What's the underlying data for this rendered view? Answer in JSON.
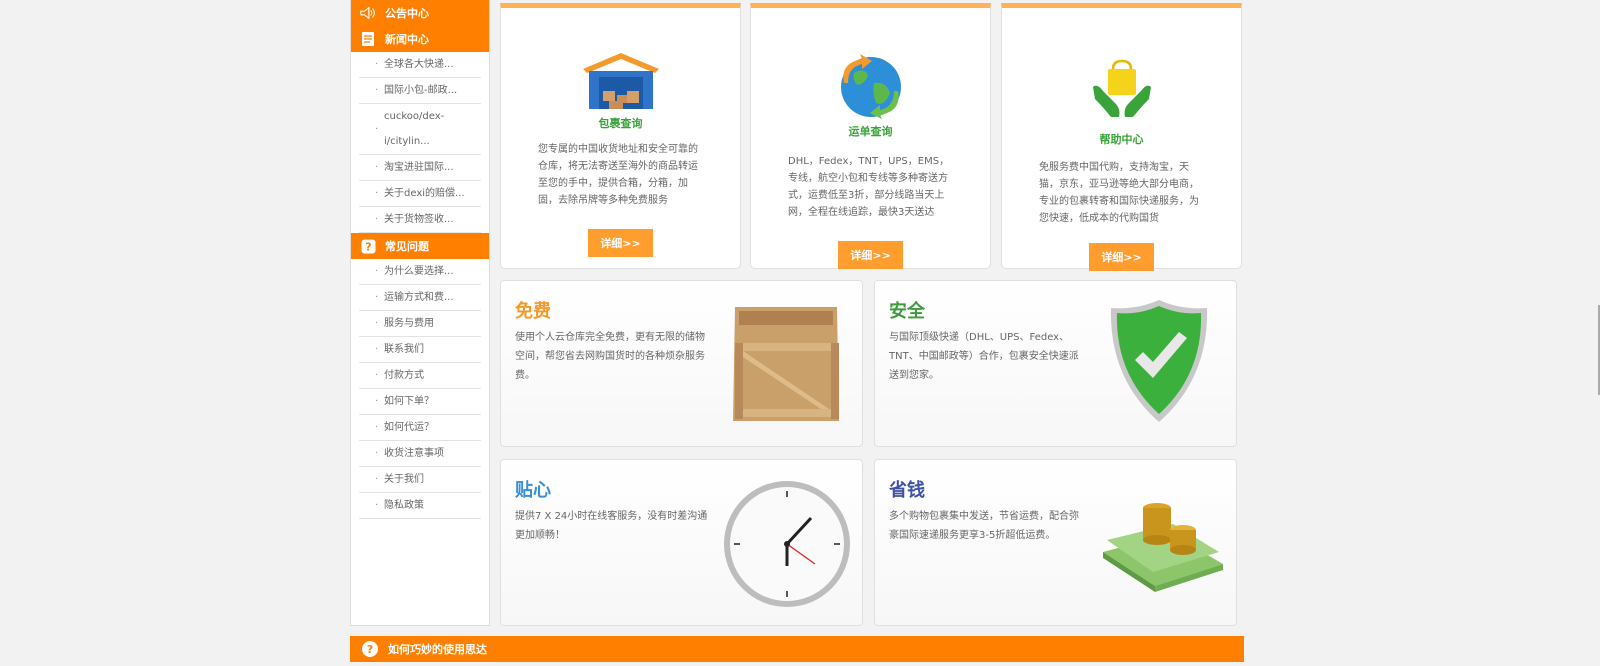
{
  "sidebar": {
    "announce_label": "公告中心",
    "news_label": "新闻中心",
    "news_items": [
      "全球各大快递...",
      "国际小包-邮政...",
      "cuckoo/dex-i/citylin...",
      "淘宝进驻国际...",
      "关于dexi的赔偿...",
      "关于货物签收..."
    ],
    "faq_label": "常见问题",
    "faq_items": [
      "为什么要选择...",
      "运输方式和费...",
      "服务与费用",
      "联系我们",
      "付款方式",
      "如何下单？",
      "如何代运？",
      "收货注意事项",
      "关于我们",
      "隐私政策"
    ]
  },
  "cards": [
    {
      "title": "包裹查询",
      "desc": "您专属的中国收货地址和安全可靠的仓库，将无法寄送至海外的商品转运至您的手中，提供合箱，分箱，加固，去除吊牌等多种免费服务",
      "button": "详细>>",
      "icon": "warehouse-icon"
    },
    {
      "title": "运单查询",
      "desc": "DHL，Fedex，TNT，UPS，EMS，专线，航空小包和专线等多种寄送方式，运费低至3折，部分线路当天上网，全程在线追踪，最快3天送达",
      "button": "详细>>",
      "icon": "globe-icon"
    },
    {
      "title": "帮助中心",
      "desc": "免服务费中国代购，支持淘宝，天猫，京东，亚马逊等绝大部分电商，专业的包裹转寄和国际快递服务，为您快速，低成本的代购国货",
      "button": "详细>>",
      "icon": "shopping-bag-icon"
    }
  ],
  "features": [
    {
      "title": "免费",
      "desc": "使用个人云仓库完全免费，更有无限的储物空间，帮您省去网购国货时的各种烦杂服务费。",
      "color": "#f39a2b",
      "icon": "crate-icon"
    },
    {
      "title": "安全",
      "desc": "与国际顶级快递（DHL、UPS、Fedex、TNT、中国邮政等）合作，包裹安全快速派送到您家。",
      "color": "#3f9a3b",
      "icon": "shield-check-icon"
    },
    {
      "title": "贴心",
      "desc": "提供7 X 24小时在线客服务，没有时差沟通更加顺畅！",
      "color": "#3a8fd6",
      "icon": "clock-icon"
    },
    {
      "title": "省钱",
      "desc": "多个购物包裹集中发送，节省运费，配合弥豪国际速递服务更享3-5折超低运费。",
      "color": "#3f51a5",
      "icon": "money-icon"
    }
  ],
  "bottom_bar": {
    "label": "如何巧妙的使用思达"
  },
  "colors": {
    "accent": "#ff7f00",
    "button": "#ff9d2e",
    "card_top": "#ffb255",
    "card_title": "#3aa43a"
  }
}
